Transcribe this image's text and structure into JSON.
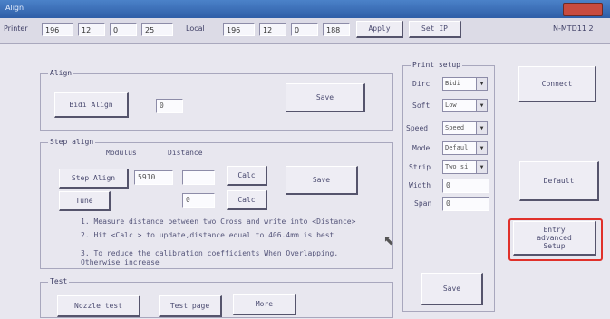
{
  "window": {
    "title": "Align"
  },
  "topbar": {
    "printer_label": "Printer",
    "printer_ip": [
      "196",
      "12",
      "0",
      "25"
    ],
    "local_label": "Local",
    "local_ip": [
      "196",
      "12",
      "0",
      "188"
    ],
    "apply_label": "Apply",
    "setip_label": "Set IP",
    "model": "N-MTD11 2"
  },
  "align": {
    "title": "Align",
    "bidi_button": "Bidi Align",
    "bidi_value": "0",
    "save_label": "Save"
  },
  "step_align": {
    "title": "Step align",
    "modulus_header": "Modulus",
    "distance_header": "Distance",
    "step_button": "Step Align",
    "modulus_value": "5910",
    "distance_value": "",
    "calc_label": "Calc",
    "tune_button": "Tune",
    "tune_value": "0",
    "save_label": "Save",
    "notes": [
      "1. Measure distance between two Cross and write into <Distance>",
      "2. Hit <Calc > to update,distance equal to 406.4mm is best",
      "3. To reduce the calibration coefficients When Overlapping,",
      "Otherwise increase"
    ]
  },
  "test": {
    "title": "Test",
    "nozzle_button": "Nozzle test",
    "page_button": "Test page",
    "more_button": "More"
  },
  "print_setup": {
    "title": "Print setup",
    "rows": [
      {
        "label": "Dirc",
        "value": "Bidi"
      },
      {
        "label": "Soft",
        "value": "Low"
      },
      {
        "label": "Speed",
        "value": "Speed"
      },
      {
        "label": "Mode",
        "value": "Defaul"
      },
      {
        "label": "Strip",
        "value": "Two si"
      }
    ],
    "width_label": "Width",
    "width_value": "0",
    "span_label": "Span",
    "span_value": "0",
    "save_label": "Save"
  },
  "right": {
    "connect_label": "Connect",
    "default_label": "Default",
    "advanced_label": "Entry advanced Setup"
  },
  "colors": {
    "highlight": "#e0302a"
  }
}
